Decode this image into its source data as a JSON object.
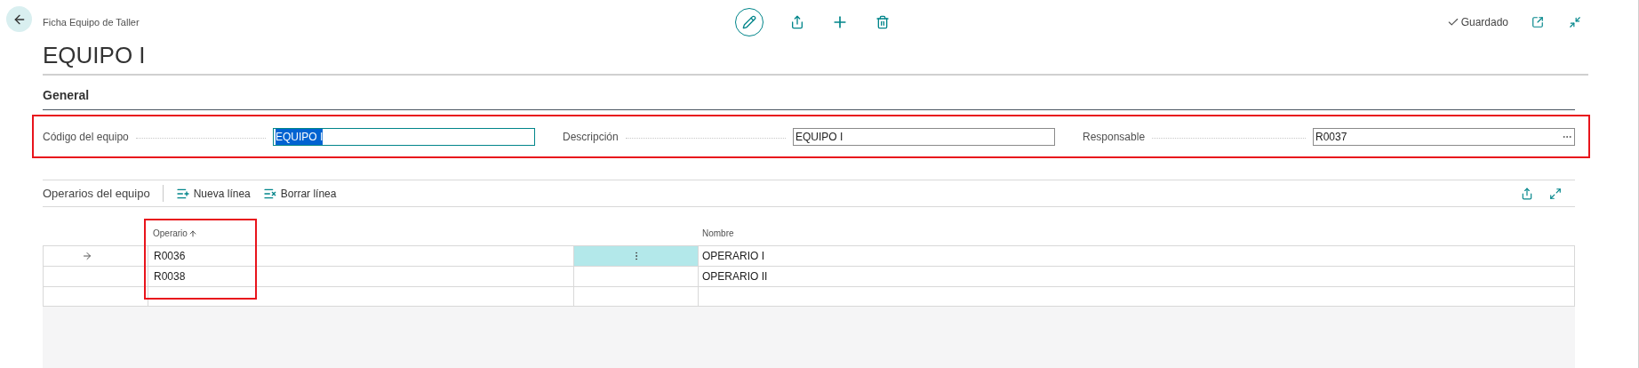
{
  "page": {
    "breadcrumb": "Ficha Equipo de Taller",
    "title": "EQUIPO I",
    "status": "Guardado"
  },
  "general": {
    "heading": "General",
    "fields": [
      {
        "label": "Código del equipo",
        "value": "EQUIPO I",
        "focused": true,
        "lookup": false
      },
      {
        "label": "Descripción",
        "value": "EQUIPO I",
        "focused": false,
        "lookup": false
      },
      {
        "label": "Responsable",
        "value": "R0037",
        "focused": false,
        "lookup": true
      }
    ]
  },
  "lines": {
    "heading": "Operarios del equipo",
    "actions": [
      {
        "label": "Nueva línea",
        "kind": "new"
      },
      {
        "label": "Borrar línea",
        "kind": "delete"
      }
    ],
    "columns": [
      {
        "label": "Operario",
        "sorted": true
      },
      {
        "label": "Nombre",
        "sorted": false
      }
    ],
    "rows": [
      {
        "current": true,
        "operario": "R0036",
        "nombre": "OPERARIO I"
      },
      {
        "current": false,
        "operario": "R0038",
        "nombre": "OPERARIO II"
      }
    ]
  }
}
